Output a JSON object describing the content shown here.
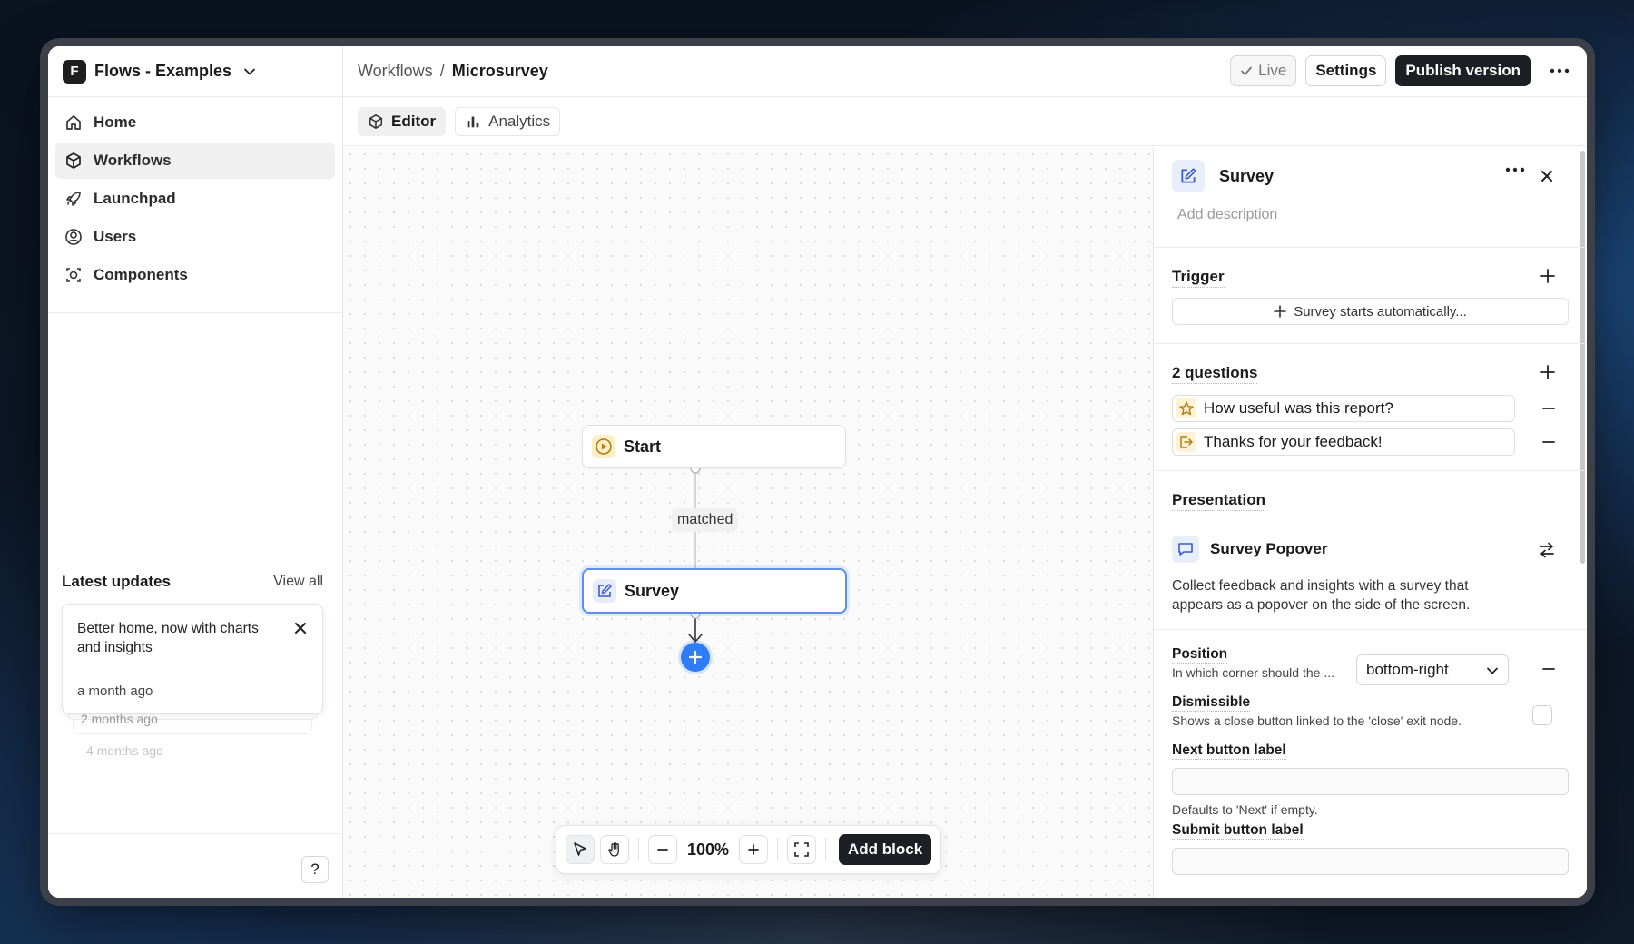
{
  "org": {
    "badge": "F",
    "name": "Flows - Examples"
  },
  "nav": [
    {
      "label": "Home",
      "icon": "home-icon"
    },
    {
      "label": "Workflows",
      "icon": "cube-icon",
      "active": true
    },
    {
      "label": "Launchpad",
      "icon": "rocket-icon"
    },
    {
      "label": "Users",
      "icon": "user-circle-icon"
    },
    {
      "label": "Components",
      "icon": "component-icon"
    }
  ],
  "updates": {
    "title": "Latest updates",
    "view_all": "View all",
    "card": {
      "text": "Better home, now with charts and insights",
      "time": "a month ago"
    },
    "ghost1": "2 months ago",
    "ghost2": "4 months ago"
  },
  "help": "?",
  "breadcrumb": {
    "parent": "Workflows",
    "sep": "/",
    "current": "Microsurvey"
  },
  "actions": {
    "live": "Live",
    "settings": "Settings",
    "publish": "Publish version"
  },
  "tabs": [
    {
      "label": "Editor",
      "active": true
    },
    {
      "label": "Analytics",
      "active": false
    }
  ],
  "canvas": {
    "nodes": {
      "start": "Start",
      "survey": "Survey"
    },
    "edge_label": "matched"
  },
  "toolbar": {
    "zoom": "100%",
    "add_block": "Add block"
  },
  "panel": {
    "title": "Survey",
    "description_placeholder": "Add description",
    "trigger": {
      "title": "Trigger",
      "button": "Survey starts automatically..."
    },
    "questions": {
      "title": "2 questions",
      "items": [
        "How useful was this report?",
        "Thanks for your feedback!"
      ]
    },
    "presentation": {
      "title": "Presentation",
      "name": "Survey Popover",
      "description": "Collect feedback and insights with a survey that appears as a popover on the side of the screen."
    },
    "position": {
      "label": "Position",
      "help": "In which corner should the ...",
      "value": "bottom-right"
    },
    "dismissible": {
      "label": "Dismissible",
      "help": "Shows a close button linked to the 'close' exit node.",
      "checked": false
    },
    "next_label": {
      "label": "Next button label",
      "help": "Defaults to 'Next' if empty.",
      "value": ""
    },
    "submit_label": {
      "label": "Submit button label",
      "value": ""
    }
  },
  "colors": {
    "accent": "#2e7cf6",
    "dark": "#1d1f24",
    "selected_border": "#5d8ff0"
  }
}
